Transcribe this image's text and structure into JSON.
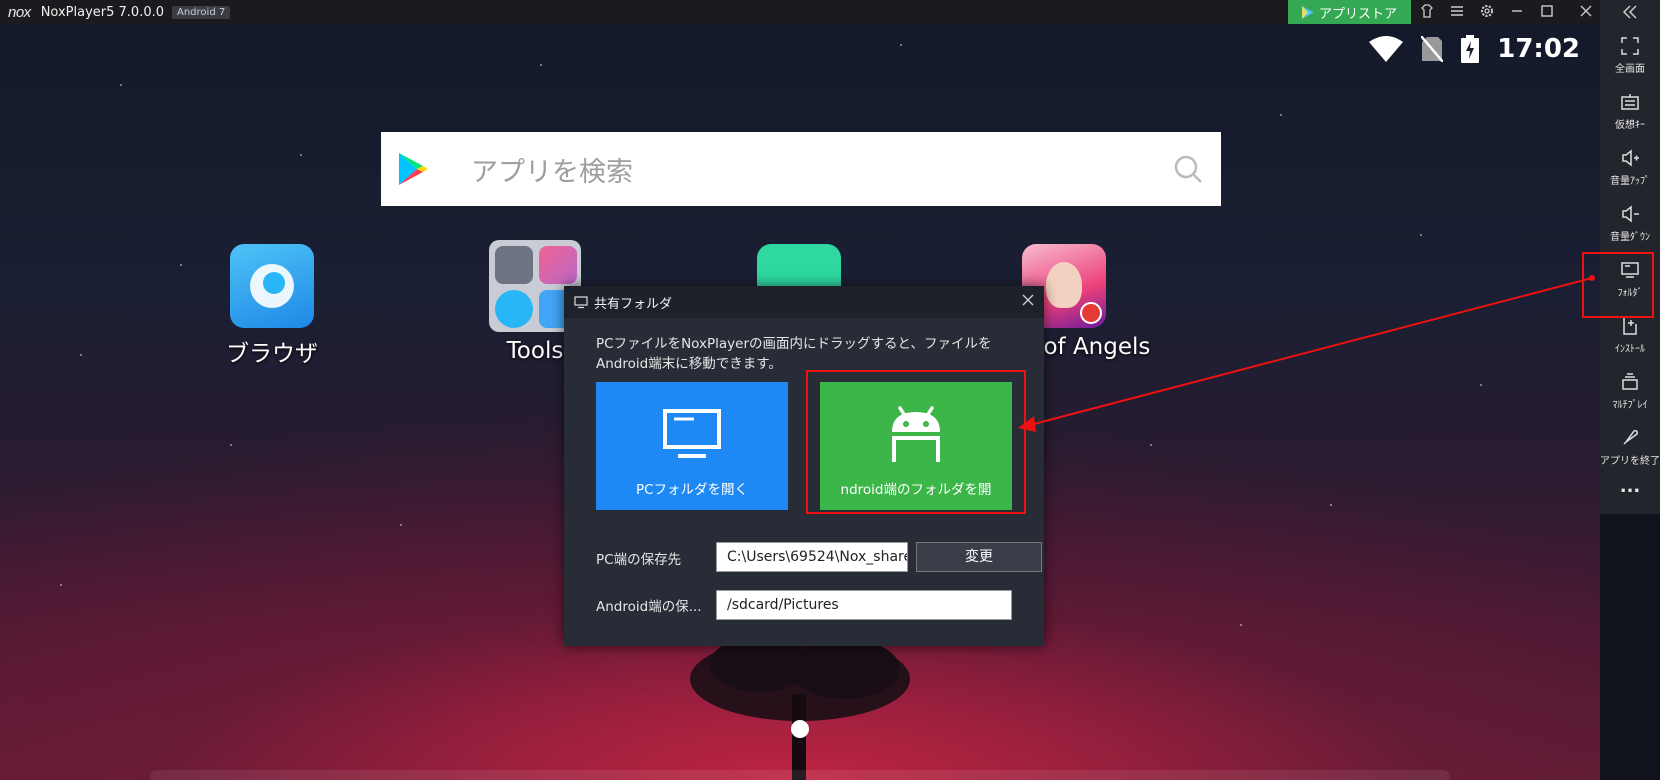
{
  "titlebar": {
    "logo": "nox",
    "app_title": "NoxPlayer5 7.0.0.0",
    "android_badge": "Android 7",
    "store_button": "アプリストア",
    "icons": [
      "theme-icon",
      "menu-icon",
      "settings-icon",
      "minimize-icon",
      "maximize-icon",
      "close-icon",
      "collapse-icon"
    ]
  },
  "status_bar": {
    "time": "17:02",
    "icons": [
      "wifi-icon",
      "no-sim-icon",
      "battery-charging-icon"
    ]
  },
  "search": {
    "placeholder": "アプリを検索"
  },
  "apps": [
    {
      "label": "ブラウザ"
    },
    {
      "label": "Tools"
    },
    {
      "label": ""
    },
    {
      "label": "e of Angels"
    }
  ],
  "sidebar": {
    "items": [
      {
        "label": "全画面",
        "icon": "fullscreen-icon"
      },
      {
        "label": "仮想ｷｰ",
        "icon": "virtual-keyboard-icon"
      },
      {
        "label": "音量ｱｯﾌﾟ",
        "icon": "volume-up-icon"
      },
      {
        "label": "音量ﾀﾞｳﾝ",
        "icon": "volume-down-icon"
      },
      {
        "label": "ﾌｫﾙﾀﾞ",
        "icon": "folder-screen-icon"
      },
      {
        "label": "ｲﾝｽﾄｰﾙ",
        "icon": "apk-install-icon"
      },
      {
        "label": "ﾏﾙﾁﾌﾟﾚｲ",
        "icon": "multi-instance-icon"
      },
      {
        "label": "アプリを終了",
        "icon": "rocket-icon"
      }
    ],
    "more": "..."
  },
  "dialog": {
    "title": "共有フォルダ",
    "description_line1": "PCファイルをNoxPlayerの画面内にドラッグすると、ファイルを",
    "description_line2": "Android端末に移動できます。",
    "pc_button": "PCフォルダを開く",
    "android_button": "ndroid端のフォルダを開",
    "pc_path_label": "PC端の保存先",
    "pc_path_value": "C:\\Users\\69524\\Nox_share",
    "change_button": "変更",
    "android_path_label": "Android端の保...",
    "android_path_value": "/sdcard/Pictures"
  },
  "colors": {
    "store_green": "#34a853",
    "pc_tile_blue": "#1e88f5",
    "android_tile_green": "#3cb648",
    "annotation_red": "#e11111"
  }
}
